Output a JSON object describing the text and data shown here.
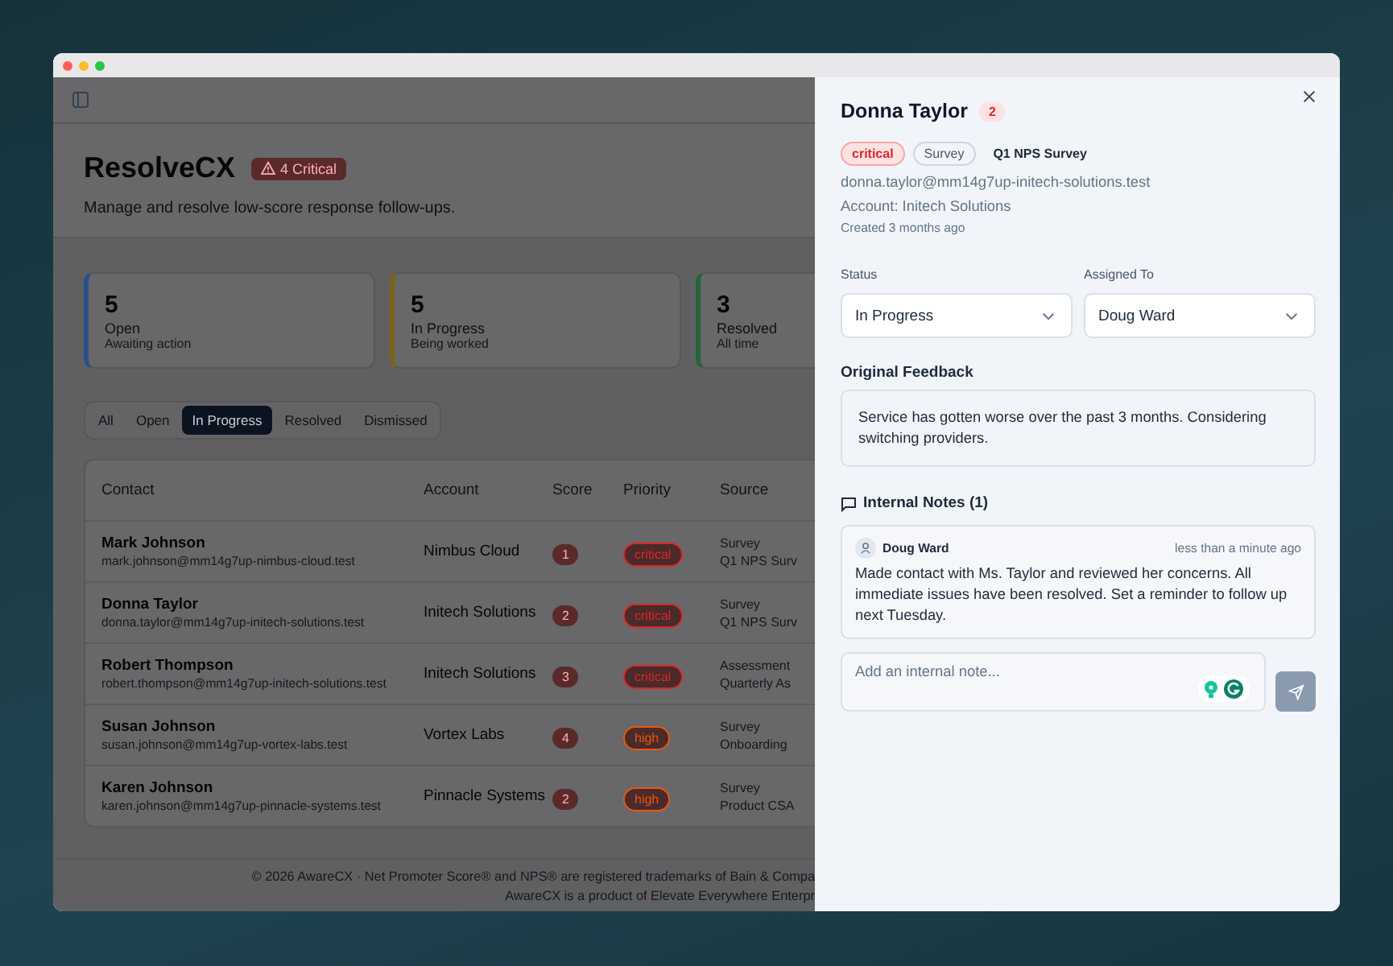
{
  "app": {
    "title": "ResolveCX",
    "critical_badge": "4 Critical",
    "subtitle": "Manage and resolve low-score response follow-ups."
  },
  "stats": [
    {
      "value": "5",
      "label": "Open",
      "sublabel": "Awaiting action",
      "color": "#2c4f8c"
    },
    {
      "value": "5",
      "label": "In Progress",
      "sublabel": "Being worked",
      "color": "#7a6418"
    },
    {
      "value": "3",
      "label": "Resolved",
      "sublabel": "All time",
      "color": "#24663a"
    }
  ],
  "filter_tabs": [
    {
      "label": "All",
      "selected": false
    },
    {
      "label": "Open",
      "selected": false
    },
    {
      "label": "In Progress",
      "selected": true
    },
    {
      "label": "Resolved",
      "selected": false
    },
    {
      "label": "Dismissed",
      "selected": false
    }
  ],
  "table": {
    "columns": [
      "Contact",
      "Account",
      "Score",
      "Priority",
      "Source"
    ],
    "rows": [
      {
        "name": "Mark Johnson",
        "email": "mark.johnson@mm14g7up-nimbus-cloud.test",
        "account": "Nimbus Cloud",
        "score": "1",
        "priority": {
          "label": "critical",
          "color": "#dc2626"
        },
        "source": "Survey",
        "source_detail": "Q1 NPS Surv"
      },
      {
        "name": "Donna Taylor",
        "email": "donna.taylor@mm14g7up-initech-solutions.test",
        "account": "Initech Solutions",
        "score": "2",
        "priority": {
          "label": "critical",
          "color": "#dc2626"
        },
        "source": "Survey",
        "source_detail": "Q1 NPS Surv"
      },
      {
        "name": "Robert Thompson",
        "email": "robert.thompson@mm14g7up-initech-solutions.test",
        "account": "Initech Solutions",
        "score": "3",
        "priority": {
          "label": "critical",
          "color": "#dc2626"
        },
        "source": "Assessment",
        "source_detail": "Quarterly As"
      },
      {
        "name": "Susan Johnson",
        "email": "susan.johnson@mm14g7up-vortex-labs.test",
        "account": "Vortex Labs",
        "score": "4",
        "priority": {
          "label": "high",
          "color": "#ea580c"
        },
        "source": "Survey",
        "source_detail": "Onboarding"
      },
      {
        "name": "Karen Johnson",
        "email": "karen.johnson@mm14g7up-pinnacle-systems.test",
        "account": "Pinnacle Systems",
        "score": "2",
        "priority": {
          "label": "high",
          "color": "#ea580c"
        },
        "source": "Survey",
        "source_detail": "Product CSA"
      }
    ]
  },
  "footer": [
    "© 2026 AwareCX · Net Promoter Score® and NPS® are registered trademarks of Bain & Compa",
    "AwareCX is a product of Elevate Everywhere Enterpr"
  ],
  "drawer": {
    "name": "Donna Taylor",
    "score": "2",
    "tags": [
      {
        "label": "critical",
        "kind": "priority"
      },
      {
        "label": "Survey",
        "kind": "source"
      },
      {
        "label": "Q1 NPS Survey",
        "kind": "campaign"
      }
    ],
    "email": "donna.taylor@mm14g7up-initech-solutions.test",
    "account": "Account: Initech Solutions",
    "created": "Created 3 months ago",
    "fields": [
      {
        "label": "Status",
        "value": "In Progress"
      },
      {
        "label": "Assigned To",
        "value": "Doug Ward"
      }
    ],
    "feedback": {
      "heading": "Original Feedback",
      "text": "Service has gotten worse over the past 3 months. Considering switching providers."
    },
    "notes": {
      "heading": "Internal Notes (1)",
      "items": [
        {
          "author": "Doug Ward",
          "time": "less than a minute ago",
          "text": "Made contact with Ms. Taylor and reviewed her concerns. All immediate issues have been resolved. Set a reminder to follow up next Tuesday."
        }
      ],
      "placeholder": "Add an internal note...",
      "send_disabled": true
    }
  }
}
